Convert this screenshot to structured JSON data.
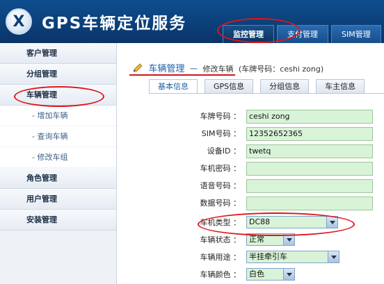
{
  "header": {
    "logo_letter": "X",
    "app_title": "GPS车辆定位服务",
    "tabs": [
      {
        "label": "监控管理"
      },
      {
        "label": "支付管理"
      },
      {
        "label": "SIM管理"
      }
    ]
  },
  "sidebar": {
    "items": [
      {
        "label": "客户管理"
      },
      {
        "label": "分组管理"
      },
      {
        "label": "车辆管理"
      },
      {
        "label": "- 增加车辆"
      },
      {
        "label": "- 查询车辆"
      },
      {
        "label": "- 修改车组"
      },
      {
        "label": "角色管理"
      },
      {
        "label": "用户管理"
      },
      {
        "label": "安装管理"
      }
    ]
  },
  "breadcrumb": {
    "main": "车辆管理",
    "dash": "一",
    "sub": "修改车辆",
    "extra": "(车牌号码：ceshi zong)"
  },
  "tabs": [
    {
      "label": "基本信息"
    },
    {
      "label": "GPS信息"
    },
    {
      "label": "分组信息"
    },
    {
      "label": "车主信息"
    }
  ],
  "form": {
    "fields": [
      {
        "label": "车牌号码 ：",
        "value": "ceshi zong"
      },
      {
        "label": "SIM号码 ：",
        "value": "12352652365"
      },
      {
        "label": "设备ID ：",
        "value": "twetq"
      },
      {
        "label": "车机密码 ：",
        "value": ""
      },
      {
        "label": "语音号码 ：",
        "value": ""
      },
      {
        "label": "数据号码 ：",
        "value": ""
      }
    ],
    "selects": [
      {
        "label": "车机类型 ：",
        "value": "DC88"
      },
      {
        "label": "车辆状态 ：",
        "value": "正常"
      },
      {
        "label": "车辆用途 ：",
        "value": "半挂牵引车"
      },
      {
        "label": "车辆颜色 ：",
        "value": "白色"
      }
    ]
  },
  "colors": {
    "header_bg": "#0b3f78",
    "accent_link": "#1f5fa8",
    "highlight_oval": "#e0141b",
    "input_bg": "#d8f3d7"
  }
}
